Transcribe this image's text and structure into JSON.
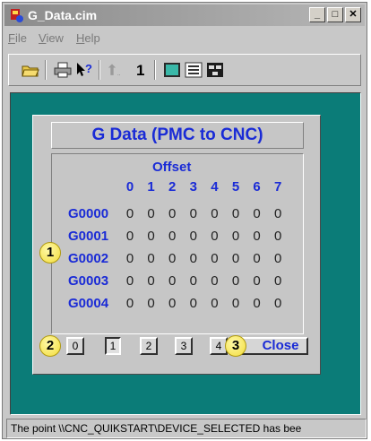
{
  "window": {
    "title": "G_Data.cim",
    "minimize": "_",
    "maximize": "□",
    "close": "✕"
  },
  "menu": [
    {
      "label": "File",
      "mnemonic": "F",
      "rest": "ile"
    },
    {
      "label": "View",
      "mnemonic": "V",
      "rest": "iew"
    },
    {
      "label": "Help",
      "mnemonic": "H",
      "rest": "elp"
    }
  ],
  "toolbar": {
    "page_number": "1",
    "icons": [
      "open-folder-icon",
      "print-icon",
      "context-help-icon",
      "previous-page-icon",
      "screen-view-icon",
      "list-view-icon",
      "tree-view-icon"
    ]
  },
  "dialog": {
    "title": "G Data (PMC to CNC)",
    "offset_label": "Offset",
    "columns": [
      "0",
      "1",
      "2",
      "3",
      "4",
      "5",
      "6",
      "7"
    ],
    "rows": [
      {
        "address": "G0000",
        "values": [
          "0",
          "0",
          "0",
          "0",
          "0",
          "0",
          "0",
          "0"
        ]
      },
      {
        "address": "G0001",
        "values": [
          "0",
          "0",
          "0",
          "0",
          "0",
          "0",
          "0",
          "0"
        ]
      },
      {
        "address": "G0002",
        "values": [
          "0",
          "0",
          "0",
          "0",
          "0",
          "0",
          "0",
          "0"
        ]
      },
      {
        "address": "G0003",
        "values": [
          "0",
          "0",
          "0",
          "0",
          "0",
          "0",
          "0",
          "0"
        ]
      },
      {
        "address": "G0004",
        "values": [
          "0",
          "0",
          "0",
          "0",
          "0",
          "0",
          "0",
          "0"
        ]
      }
    ],
    "page_buttons": [
      "0",
      "1",
      "2",
      "3",
      "4"
    ],
    "selected_page": "1",
    "close_label": "Close"
  },
  "callouts": [
    "1",
    "2",
    "3"
  ],
  "status": {
    "text": "The point \\\\CNC_QUIKSTART\\DEVICE_SELECTED has bee"
  },
  "colors": {
    "accent_blue": "#1a2bd6",
    "client_teal": "#0b7c78",
    "callout_yellow": "#f2dc3a"
  }
}
